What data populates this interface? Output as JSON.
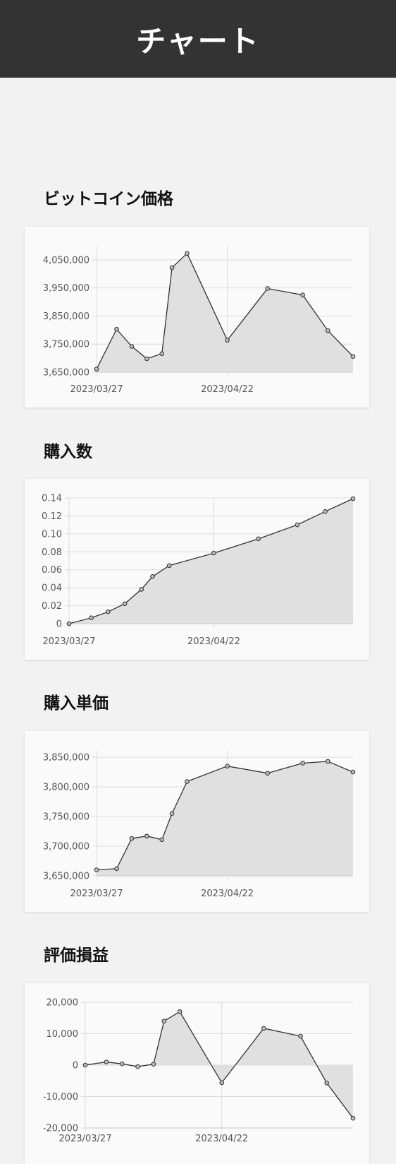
{
  "header": {
    "title": "チャート"
  },
  "colors": {
    "header_bg": "#333333",
    "line": "#333333",
    "fill": "#e0e0e0",
    "grid": "#dcdcdc",
    "page_bg": "#f2f2f2",
    "card_bg": "#fafafa"
  },
  "sections": [
    {
      "title": "ビットコイン価格"
    },
    {
      "title": "購入数"
    },
    {
      "title": "購入単価"
    },
    {
      "title": "評価損益"
    }
  ],
  "chart_data": [
    {
      "type": "area",
      "title": "",
      "x": [
        "2023/03/27",
        "2023/03/31",
        "2023/04/03",
        "2023/04/06",
        "2023/04/09",
        "2023/04/11",
        "2023/04/14",
        "2023/04/22",
        "2023/04/30",
        "2023/05/07",
        "2023/05/12",
        "2023/05/17"
      ],
      "x_tick_labels": [
        "2023/03/27",
        "2023/04/22"
      ],
      "values": [
        3661000,
        3803000,
        3742000,
        3698000,
        3716000,
        4022000,
        4073000,
        3764000,
        3948000,
        3925000,
        3798000,
        3706000
      ],
      "y_ticks": [
        3650000,
        3750000,
        3850000,
        3950000,
        4050000
      ],
      "y_tick_labels": [
        "3,650,000",
        "3,750,000",
        "3,850,000",
        "3,950,000",
        "4,050,000"
      ],
      "ylim": [
        3650000,
        4100000
      ],
      "grid": true,
      "legend": "none"
    },
    {
      "type": "area",
      "title": "",
      "x": [
        "2023/03/27",
        "2023/03/31",
        "2023/04/03",
        "2023/04/06",
        "2023/04/09",
        "2023/04/11",
        "2023/04/14",
        "2023/04/22",
        "2023/04/30",
        "2023/05/07",
        "2023/05/12",
        "2023/05/17"
      ],
      "x_tick_labels": [
        "2023/03/27",
        "2023/04/22"
      ],
      "values": [
        0,
        0.0065,
        0.0132,
        0.0222,
        0.0382,
        0.0525,
        0.0647,
        0.0786,
        0.0945,
        0.1101,
        0.1249,
        0.1392
      ],
      "y_ticks": [
        0,
        0.02,
        0.04,
        0.06,
        0.08,
        0.1,
        0.12,
        0.14
      ],
      "y_tick_labels": [
        "0",
        "0.02",
        "0.04",
        "0.06",
        "0.08",
        "0.10",
        "0.12",
        "0.14"
      ],
      "ylim": [
        0,
        0.14
      ],
      "grid": true,
      "legend": "none"
    },
    {
      "type": "area",
      "title": "",
      "x": [
        "2023/03/27",
        "2023/03/31",
        "2023/04/03",
        "2023/04/06",
        "2023/04/09",
        "2023/04/11",
        "2023/04/14",
        "2023/04/22",
        "2023/04/30",
        "2023/05/07",
        "2023/05/12",
        "2023/05/17"
      ],
      "x_tick_labels": [
        "2023/03/27",
        "2023/04/22"
      ],
      "values": [
        3660000,
        3662000,
        3713000,
        3717000,
        3711000,
        3755000,
        3809000,
        3835000,
        3823000,
        3840000,
        3843000,
        3825000
      ],
      "y_ticks": [
        3650000,
        3700000,
        3750000,
        3800000,
        3850000
      ],
      "y_tick_labels": [
        "3,650,000",
        "3,700,000",
        "3,750,000",
        "3,800,000",
        "3,850,000"
      ],
      "ylim": [
        3650000,
        3862000
      ],
      "grid": true,
      "legend": "none"
    },
    {
      "type": "area",
      "title": "",
      "x": [
        "2023/03/27",
        "2023/03/31",
        "2023/04/03",
        "2023/04/06",
        "2023/04/09",
        "2023/04/11",
        "2023/04/14",
        "2023/04/22",
        "2023/04/30",
        "2023/05/07",
        "2023/05/12",
        "2023/05/17"
      ],
      "x_tick_labels": [
        "2023/03/27",
        "2023/04/22"
      ],
      "values": [
        0,
        1000,
        400,
        -500,
        300,
        14000,
        17000,
        -5600,
        11700,
        9200,
        -5700,
        -16900
      ],
      "y_ticks": [
        -20000,
        -10000,
        0,
        10000,
        20000
      ],
      "y_tick_labels": [
        "-20,000",
        "-10,000",
        "0",
        "10,000",
        "20,000"
      ],
      "ylim": [
        -20000,
        20000
      ],
      "grid": true,
      "legend": "none"
    }
  ]
}
